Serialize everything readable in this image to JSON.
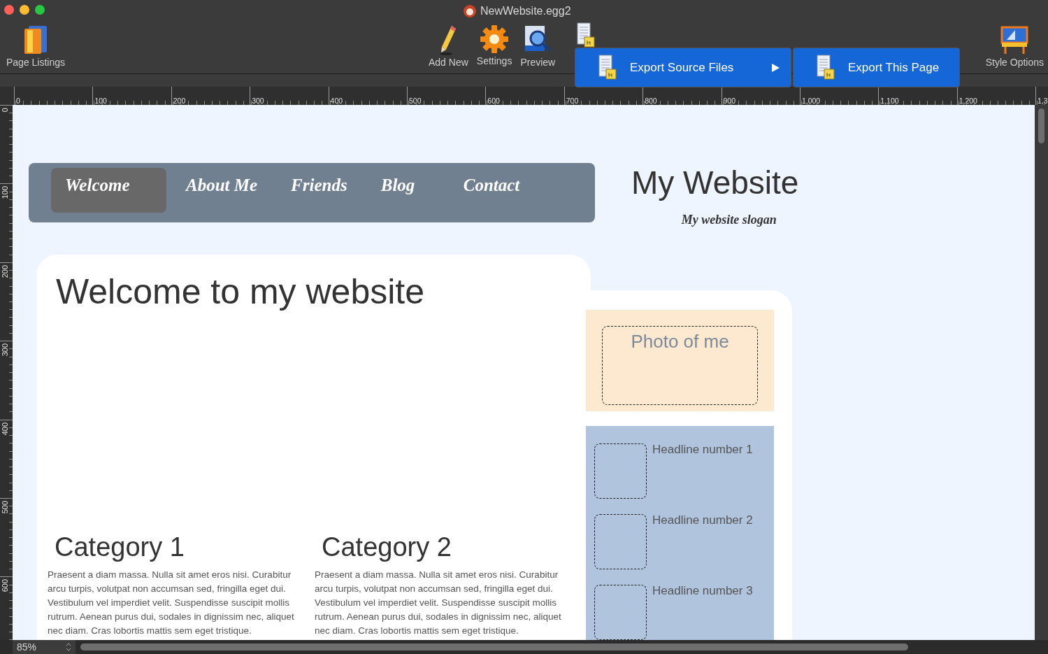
{
  "window": {
    "title": "NewWebsite.egg2"
  },
  "toolbar": {
    "left": [
      {
        "label": "Page Listings",
        "kind": "pages"
      }
    ],
    "center": [
      {
        "label": "Add New",
        "kind": "pencil"
      },
      {
        "label": "Settings",
        "kind": "gear"
      },
      {
        "label": "Preview",
        "kind": "preview"
      }
    ],
    "right": [
      {
        "label": "Style Options",
        "kind": "style"
      }
    ]
  },
  "export_menu": {
    "items": [
      {
        "label": "Export Source Files",
        "selected": true
      }
    ],
    "submenu": [
      {
        "label": "Export This Page",
        "selected": true
      }
    ]
  },
  "ruler_h": [
    "0",
    "100",
    "200",
    "300",
    "400",
    "500",
    "600",
    "700",
    "800",
    "900",
    "1,000",
    "1,100",
    "1,200",
    "1,3"
  ],
  "ruler_v": [
    "0",
    "100",
    "200",
    "300",
    "400",
    "500",
    "600"
  ],
  "page": {
    "nav": [
      {
        "label": "Welcome",
        "selected": true
      },
      {
        "label": "About Me",
        "selected": false
      },
      {
        "label": "Friends",
        "selected": false
      },
      {
        "label": "Blog",
        "selected": false
      },
      {
        "label": "Contact",
        "selected": false
      }
    ],
    "site_title": "My Website",
    "slogan": "My website slogan",
    "heading": "Welcome to my website",
    "categories": [
      {
        "title": "Category 1",
        "body": "Praesent a diam massa. Nulla sit amet eros nisi. Curabitur arcu turpis, volutpat non accumsan sed, fringilla eget dui. Vestibulum vel imperdiet velit. Suspendisse suscipit mollis rutrum. Aenean purus dui, sodales in dignissim nec, aliquet nec diam. Cras lobortis mattis sem eget tristique."
      },
      {
        "title": "Category 2",
        "body": "Praesent a diam massa. Nulla sit amet eros nisi. Curabitur arcu turpis, volutpat non accumsan sed, fringilla eget dui. Vestibulum vel imperdiet velit. Suspendisse suscipit mollis rutrum. Aenean purus dui, sodales in dignissim nec, aliquet nec diam. Cras lobortis mattis sem eget tristique."
      }
    ],
    "photo_label": "Photo of me",
    "headlines": [
      "Headline number 1",
      "Headline number 2",
      "Headline number 3"
    ]
  },
  "status": {
    "zoom": "85%"
  }
}
